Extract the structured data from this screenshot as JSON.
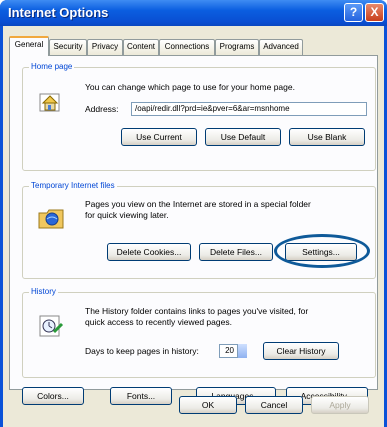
{
  "window": {
    "title": "Internet Options",
    "help_glyph": "?",
    "close_glyph": "X"
  },
  "tabs": [
    {
      "label": "General",
      "selected": true
    },
    {
      "label": "Security"
    },
    {
      "label": "Privacy"
    },
    {
      "label": "Content"
    },
    {
      "label": "Connections"
    },
    {
      "label": "Programs"
    },
    {
      "label": "Advanced"
    }
  ],
  "home_page": {
    "title": "Home page",
    "description": "You can change which page to use for your home page.",
    "address_label": "Address:",
    "address_value": "/oapi/redir.dll?prd=ie&pver=6&ar=msnhome",
    "use_current": "Use Current",
    "use_default": "Use Default",
    "use_blank": "Use Blank"
  },
  "temp_files": {
    "title": "Temporary Internet files",
    "description_line1": "Pages you view on the Internet are stored in a special folder",
    "description_line2": "for quick viewing later.",
    "delete_cookies": "Delete Cookies...",
    "delete_files": "Delete Files...",
    "settings": "Settings..."
  },
  "history": {
    "title": "History",
    "description_line1": "The History folder contains links to pages you've visited, for",
    "description_line2": "quick access to recently viewed pages.",
    "days_label": "Days to keep pages in history:",
    "days_value": "20",
    "clear_history": "Clear History"
  },
  "bottom_buttons": {
    "colors": "Colors...",
    "fonts": "Fonts...",
    "languages": "Languages...",
    "accessibility": "Accessibility..."
  },
  "dialog_buttons": {
    "ok": "OK",
    "cancel": "Cancel",
    "apply": "Apply"
  },
  "colors": {
    "title_bar": "#0a52d8",
    "group_title": "#0046d5",
    "annotation_ring": "#0f5a99"
  }
}
